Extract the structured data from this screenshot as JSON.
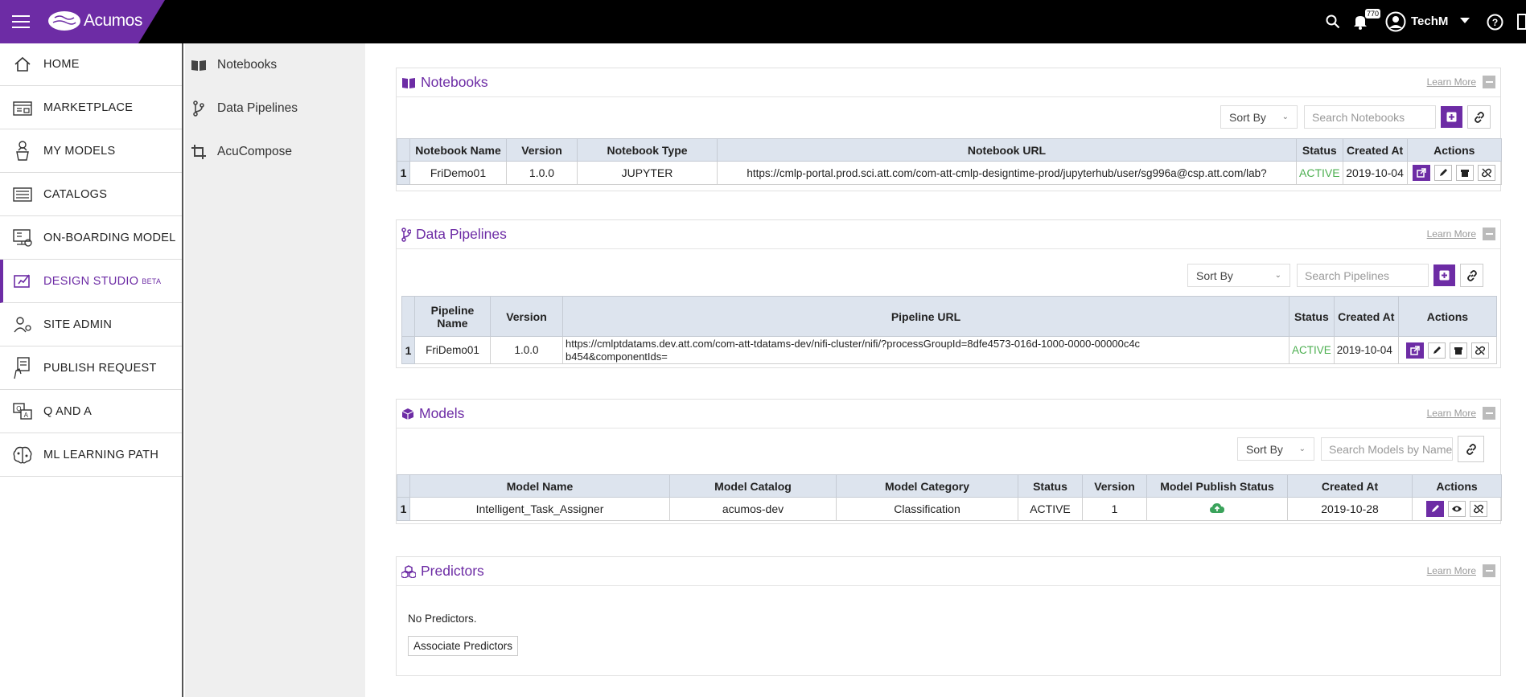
{
  "app": {
    "brand": "Acumos"
  },
  "topbar": {
    "notification_count": "770",
    "user_name": "TechM"
  },
  "sidebar": {
    "items": [
      {
        "label": "HOME",
        "icon": "home-icon"
      },
      {
        "label": "MARKETPLACE",
        "icon": "marketplace-icon"
      },
      {
        "label": "MY MODELS",
        "icon": "my-models-icon"
      },
      {
        "label": "CATALOGS",
        "icon": "catalogs-icon"
      },
      {
        "label": "ON-BOARDING MODEL",
        "icon": "onboarding-icon"
      },
      {
        "label": "DESIGN STUDIO",
        "sup": "BETA",
        "icon": "design-studio-icon",
        "active": true
      },
      {
        "label": "SITE ADMIN",
        "icon": "site-admin-icon"
      },
      {
        "label": "PUBLISH REQUEST",
        "icon": "publish-request-icon"
      },
      {
        "label": "Q AND A",
        "icon": "qanda-icon"
      },
      {
        "label": "ML LEARNING PATH",
        "icon": "brain-icon"
      }
    ]
  },
  "subnav": {
    "items": [
      {
        "label": "Notebooks",
        "icon": "book-icon"
      },
      {
        "label": "Data Pipelines",
        "icon": "branch-icon"
      },
      {
        "label": "AcuCompose",
        "icon": "crop-icon"
      }
    ]
  },
  "notebooks": {
    "title": "Notebooks",
    "learn_more": "Learn More",
    "sort_by": "Sort By",
    "search_placeholder": "Search Notebooks",
    "columns": [
      "Notebook Name",
      "Version",
      "Notebook Type",
      "Notebook URL",
      "Status",
      "Created At",
      "Actions"
    ],
    "rows": [
      {
        "index": "1",
        "name": "FriDemo01",
        "version": "1.0.0",
        "type": "JUPYTER",
        "url": "https://cmlp-portal.prod.sci.att.com/com-att-cmlp-designtime-prod/jupyterhub/user/sg996a@csp.att.com/lab?",
        "status": "ACTIVE",
        "created": "2019-10-04"
      }
    ]
  },
  "pipelines": {
    "title": "Data Pipelines",
    "learn_more": "Learn More",
    "sort_by": "Sort By",
    "search_placeholder": "Search Pipelines",
    "columns": [
      "Pipeline Name",
      "Version",
      "Pipeline URL",
      "Status",
      "Created At",
      "Actions"
    ],
    "rows": [
      {
        "index": "1",
        "name": "FriDemo01",
        "version": "1.0.0",
        "url": "https://cmlptdatams.dev.att.com/com-att-tdatams-dev/nifi-cluster/nifi/?processGroupId=8dfe4573-016d-1000-0000-00000c4cb454&componentIds=",
        "status": "ACTIVE",
        "created": "2019-10-04"
      }
    ]
  },
  "models": {
    "title": "Models",
    "learn_more": "Learn More",
    "sort_by": "Sort By",
    "search_placeholder": "Search Models by Name",
    "columns": [
      "Model Name",
      "Model Catalog",
      "Model Category",
      "Status",
      "Version",
      "Model Publish Status",
      "Created At",
      "Actions"
    ],
    "rows": [
      {
        "index": "1",
        "name": "Intelligent_Task_Assigner",
        "catalog": "acumos-dev",
        "category": "Classification",
        "status": "ACTIVE",
        "version": "1",
        "publish_icon": "cloud-upload-icon",
        "created": "2019-10-28"
      }
    ]
  },
  "predictors": {
    "title": "Predictors",
    "learn_more": "Learn More",
    "empty_text": "No Predictors.",
    "associate_label": "Associate Predictors"
  },
  "colors": {
    "accent": "#6d2ca5",
    "active_status": "#4caf50",
    "header_bg": "#dde4ee"
  }
}
